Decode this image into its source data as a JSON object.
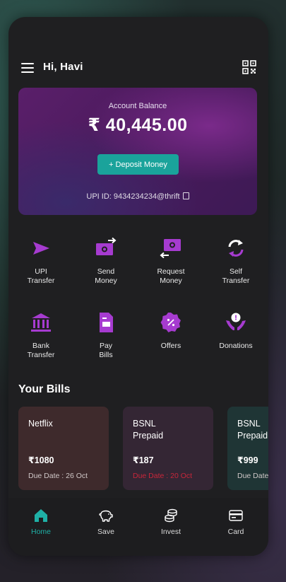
{
  "header": {
    "greeting": "Hi, Havi"
  },
  "balance": {
    "label": "Account Balance",
    "amount": "₹ 40,445.00",
    "deposit_label": "+ Deposit Money",
    "upi_id": "UPI ID: 9434234234@thrift"
  },
  "actions": [
    {
      "label": "UPI\nTransfer",
      "icon": "send-icon"
    },
    {
      "label": "Send\nMoney",
      "icon": "send-money-icon"
    },
    {
      "label": "Request\nMoney",
      "icon": "request-money-icon"
    },
    {
      "label": "Self\nTransfer",
      "icon": "self-transfer-icon"
    },
    {
      "label": "Bank\nTransfer",
      "icon": "bank-icon"
    },
    {
      "label": "Pay\nBills",
      "icon": "bill-icon"
    },
    {
      "label": "Offers",
      "icon": "offers-icon"
    },
    {
      "label": "Donations",
      "icon": "donations-icon"
    }
  ],
  "bills": {
    "title": "Your Bills",
    "items": [
      {
        "name": "Netflix",
        "amount": "₹1080",
        "due": "Due Date : 26 Oct",
        "overdue": false,
        "color": "#3e2a2c"
      },
      {
        "name": "BSNL\nPrepaid",
        "amount": "₹187",
        "due": "Due Date : 20 Oct",
        "overdue": true,
        "color": "#342634"
      },
      {
        "name": "BSNL\nPrepaid",
        "amount": "₹999",
        "due": "Due Date",
        "overdue": false,
        "color": "#1f3535"
      }
    ]
  },
  "nav": [
    {
      "label": "Home",
      "icon": "home-icon",
      "active": true
    },
    {
      "label": "Save",
      "icon": "piggy-bank-icon",
      "active": false
    },
    {
      "label": "Invest",
      "icon": "coins-icon",
      "active": false
    },
    {
      "label": "Card",
      "icon": "card-icon",
      "active": false
    }
  ],
  "colors": {
    "accent_purple": "#a63bd0",
    "accent_teal": "#1aa39b",
    "overdue_red": "#c8263a"
  }
}
